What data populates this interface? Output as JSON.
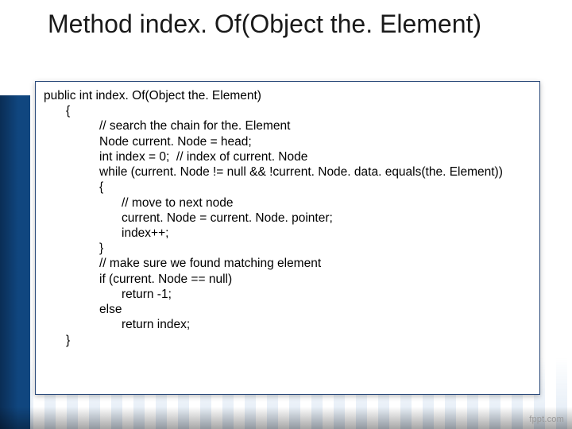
{
  "title": "Method index. Of(Object the. Element)",
  "watermark": "fppt.com",
  "code": {
    "signature": "public int index. Of(Object the. Element)",
    "open_brace": "{",
    "l1": "// search the chain for the. Element",
    "l2": "Node current. Node = head;",
    "l3": "int index = 0;  // index of current. Node",
    "l4": "while (current. Node != null && !current. Node. data. equals(the. Element))",
    "l5": "{",
    "l6": "// move to next node",
    "l7": "current. Node = current. Node. pointer;",
    "l8": "index++;",
    "l9": "}",
    "l10": "// make sure we found matching element",
    "l11": "if (current. Node == null)",
    "l12": "return -1;",
    "l13": "else",
    "l14": "return index;",
    "close_brace": "}"
  }
}
